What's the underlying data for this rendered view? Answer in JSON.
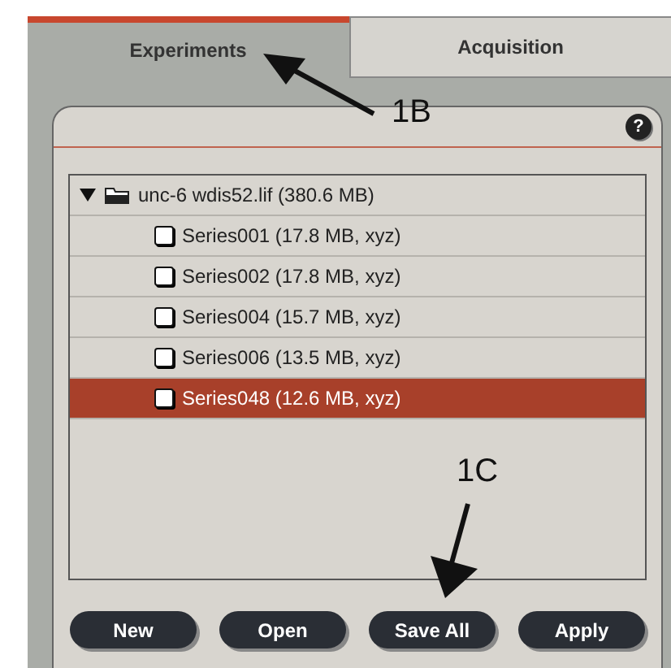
{
  "tabs": [
    {
      "label": "Experiments",
      "selected": true
    },
    {
      "label": "Acquisition",
      "selected": false
    }
  ],
  "help_button": {
    "label": "?"
  },
  "tree": {
    "label": "unc-6 wdis52.lif (380.6 MB)",
    "expanded": true,
    "children": [
      {
        "label": "Series001 (17.8 MB, xyz)",
        "checked": false,
        "selected": false
      },
      {
        "label": "Series002 (17.8 MB, xyz)",
        "checked": false,
        "selected": false
      },
      {
        "label": "Series004 (15.7 MB, xyz)",
        "checked": false,
        "selected": false
      },
      {
        "label": "Series006 (13.5 MB, xyz)",
        "checked": false,
        "selected": false
      },
      {
        "label": "Series048 (12.6 MB, xyz)",
        "checked": false,
        "selected": true
      }
    ]
  },
  "buttons": [
    "New",
    "Open",
    "Save All",
    "Apply"
  ],
  "annotations": [
    {
      "label": "1B",
      "kind": "upleft"
    },
    {
      "label": "1C",
      "kind": "down"
    }
  ]
}
